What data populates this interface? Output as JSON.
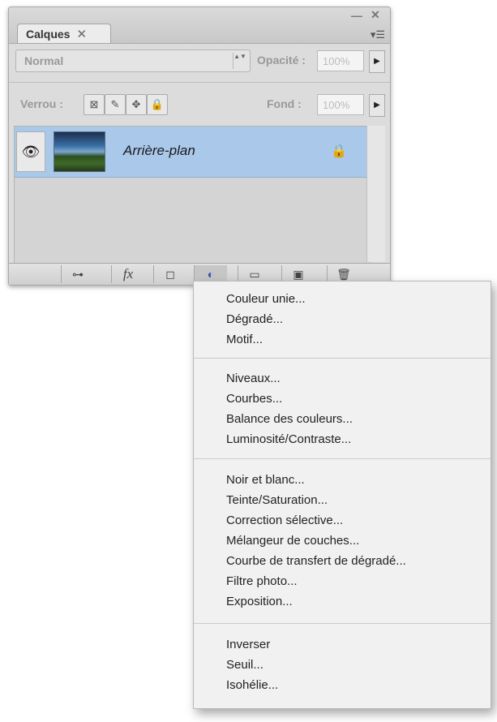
{
  "panel": {
    "tab_label": "Calques",
    "tab_close": "✕",
    "minimize": "—",
    "close": "✕",
    "panel_menu": "▾☰",
    "blend_mode": "Normal",
    "opacity_label": "Opacité :",
    "opacity_value": "100%",
    "lock_label": "Verrou :",
    "fill_label": "Fond :",
    "fill_value": "100%",
    "arrow": "▶",
    "stepper": "▲▼"
  },
  "layer": {
    "name": "Arrière-plan",
    "eye": "👁",
    "lock": "🔒"
  },
  "toolbar": {
    "link": "⊶",
    "fx": "fx",
    "mask": "◻",
    "adjust": "◐",
    "group": "▭",
    "new": "▣",
    "trash": "🗑"
  },
  "lock_icons": {
    "pixels": "⊠",
    "brush": "✎",
    "move": "✥",
    "all": "🔒"
  },
  "menu": {
    "g1": [
      "Couleur unie...",
      "Dégradé...",
      "Motif..."
    ],
    "g2": [
      "Niveaux...",
      "Courbes...",
      "Balance des couleurs...",
      "Luminosité/Contraste..."
    ],
    "g3": [
      "Noir et blanc...",
      "Teinte/Saturation...",
      "Correction sélective...",
      "Mélangeur de couches...",
      "Courbe de transfert de dégradé...",
      "Filtre photo...",
      "Exposition..."
    ],
    "g4": [
      "Inverser",
      "Seuil...",
      "Isohélie..."
    ]
  }
}
